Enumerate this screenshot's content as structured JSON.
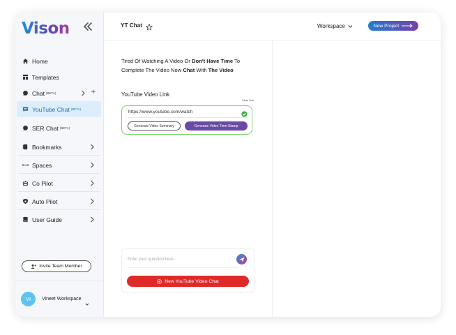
{
  "brand": {
    "logo_text": "Vison"
  },
  "sidebar": {
    "items": [
      {
        "label": "Home",
        "icon": "home-icon"
      },
      {
        "label": "Templates",
        "icon": "templates-icon"
      },
      {
        "label": "Chat",
        "badge": "(BETA)",
        "icon": "chat-bubble-icon"
      },
      {
        "label": "YouTube Chat",
        "badge": "(BETA)",
        "icon": "youtube-chat-icon",
        "active": true
      },
      {
        "label": "SER Chat",
        "badge": "(BETA)",
        "icon": "ser-chat-icon"
      },
      {
        "label": "Bookmarks",
        "icon": "bookmark-icon"
      },
      {
        "label": "Spaces",
        "icon": "spaces-icon"
      },
      {
        "label": "Co Pilot",
        "icon": "copilot-icon"
      },
      {
        "label": "Auto Pilot",
        "icon": "autopilot-icon"
      },
      {
        "label": "User Guide",
        "icon": "book-icon"
      }
    ],
    "invite_label": "Invite Team Member",
    "workspace": {
      "initials": "VI",
      "name": "Vineet Workspace"
    }
  },
  "header": {
    "title": "YT Chat",
    "workspace_label": "Workspace",
    "new_project_label": "New Project"
  },
  "main": {
    "intro": {
      "t1": "Tired Of Watching A Video Or ",
      "b1": "Don't  Have Time",
      "t2": " To Complete The Video Now ",
      "b2": "Chat",
      "t3": " With ",
      "b3": "The Video"
    },
    "link_label": "YouTube Video Link",
    "clear_label": "Clear Link",
    "url_value": "https://www.youtube.com/watch",
    "summary_button": "Generate Video Summary",
    "timestamp_button": "Generate Video Time Stamp",
    "question_placeholder": "Enter your question here...",
    "new_chat_button": "New YouTube Video Chat"
  },
  "colors": {
    "accent_blue": "#1f7fd0",
    "accent_purple": "#6a4aa5",
    "active_bg": "#dceefb",
    "success_green": "#3cb043",
    "danger_red": "#e02a2a"
  }
}
